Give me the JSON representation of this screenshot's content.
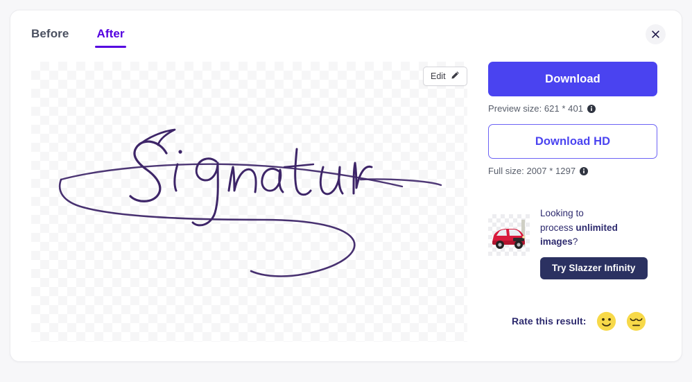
{
  "modal": {
    "close_label": "Close",
    "tabs": [
      {
        "label": "Before",
        "active": false
      },
      {
        "label": "After",
        "active": true
      }
    ]
  },
  "preview": {
    "edit_label": "Edit",
    "edit_icon": "pencil-icon",
    "image_alt": "Signature",
    "background": "transparent-checkerboard"
  },
  "actions": {
    "download_label": "Download",
    "preview_size_text": "Preview size: 621 * 401",
    "download_hd_label": "Download HD",
    "full_size_text": "Full size: 2007 * 1297",
    "info_icon": "info-icon"
  },
  "promo": {
    "thumb_alt": "red-car-cutout",
    "line1": "Looking to",
    "line2_pre": "process ",
    "line2_bold": "unlimited",
    "line3_bold": "images",
    "line3_post": "?",
    "cta_label": "Try Slazzer Infinity"
  },
  "rating": {
    "label": "Rate this result:",
    "options": [
      {
        "name": "slightly-smiling-face",
        "value": "positive"
      },
      {
        "name": "pensive-face",
        "value": "negative"
      }
    ]
  },
  "colors": {
    "accent_violet": "#5400e0",
    "primary_blue": "#4a43f0",
    "navy": "#2b3161",
    "promo_text": "#2d2a6e",
    "emoji_yellow": "#f7d949",
    "muted_text": "#565c69",
    "signature_ink": "#3d2568"
  }
}
